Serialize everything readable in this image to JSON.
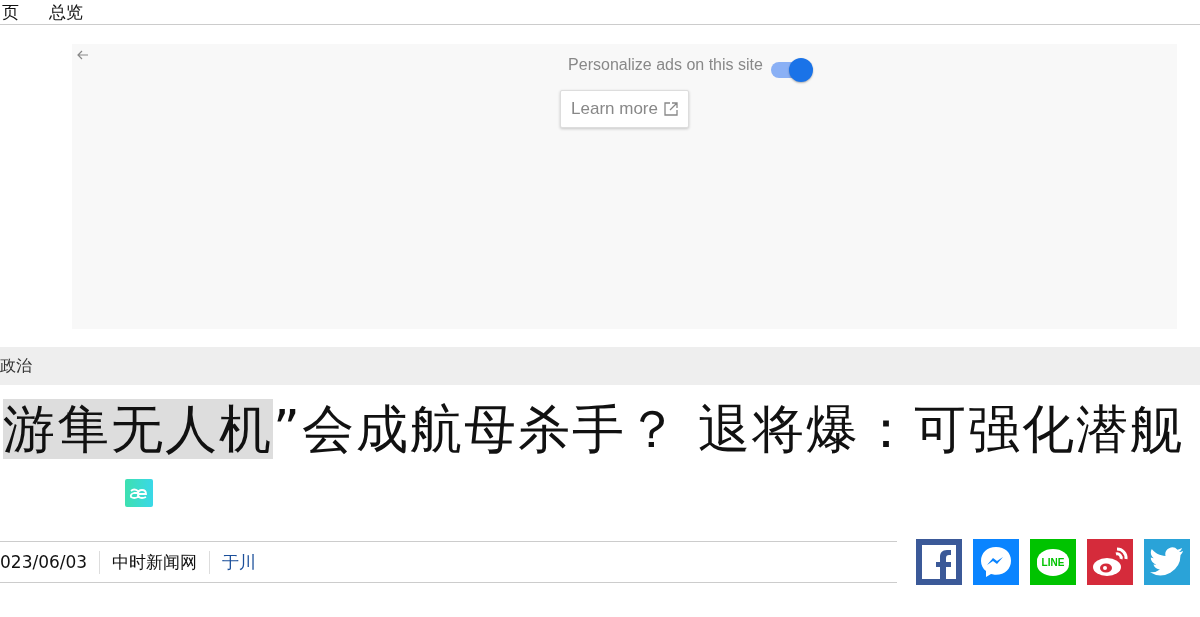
{
  "nav": {
    "items": [
      "页",
      "总览"
    ]
  },
  "ad_settings": {
    "label": "Personalize ads on this site",
    "on": true,
    "button": "Learn more"
  },
  "category": "政治",
  "headline": {
    "highlight": "游隼无人机",
    "rest": "”会成航母杀手？ 退将爆：可强化潜舰"
  },
  "meta": {
    "date": "023/06/03",
    "source": "中时新闻网",
    "author": "于川"
  },
  "share": [
    {
      "kind": "facebook"
    },
    {
      "kind": "messenger"
    },
    {
      "kind": "line",
      "label": "LINE"
    },
    {
      "kind": "weibo"
    },
    {
      "kind": "twitter"
    }
  ]
}
